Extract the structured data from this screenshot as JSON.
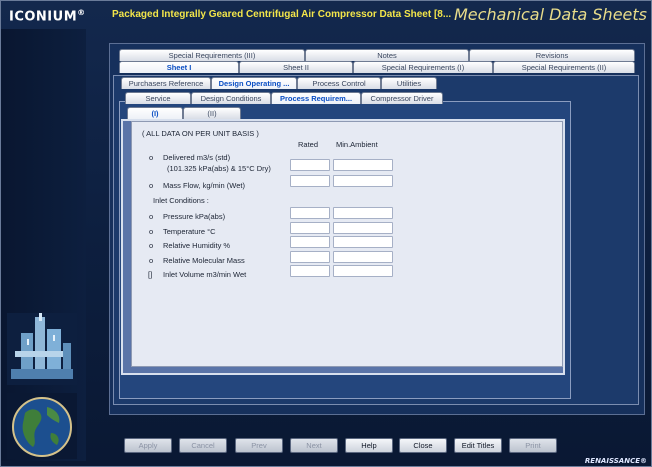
{
  "header": {
    "logo": "ICONIUM",
    "logo_mark": "®",
    "title": "Packaged Integrally Geared Centrifugal Air Compressor Data Sheet [8...",
    "module": "Mechanical Data Sheets"
  },
  "tabs_row1": [
    "Special Requirements (III)",
    "Notes",
    "Revisions"
  ],
  "tabs_row2": [
    "Sheet I",
    "Sheet II",
    "Special Requirements (I)",
    "Special Requirements (II)"
  ],
  "tabs_row3": [
    "Purchasers Reference",
    "Design Operating ...",
    "Process Control",
    "Utilities"
  ],
  "tabs_row4": [
    "Service",
    "Design Conditions",
    "Process Requirem...",
    "Compressor Driver"
  ],
  "tabs_row5": [
    "(I)",
    "(II)"
  ],
  "form": {
    "note": "( ALL DATA ON PER UNIT BASIS )",
    "col_rated": "Rated",
    "col_min_ambient": "Min.Ambient",
    "rows": [
      {
        "bullet": "o",
        "label": "Delivered m3/s (std)",
        "sub": "(101.325 kPa(abs) & 15°C Dry)"
      },
      {
        "bullet": "o",
        "label": "Mass Flow, kg/min (Wet)"
      },
      {
        "bullet": "",
        "label": "Inlet Conditions :"
      },
      {
        "bullet": "o",
        "label": "Pressure kPa(abs)"
      },
      {
        "bullet": "o",
        "label": "Temperature °C"
      },
      {
        "bullet": "o",
        "label": "Relative Humidity %"
      },
      {
        "bullet": "o",
        "label": "Relative Molecular Mass"
      },
      {
        "bullet": "[]",
        "label": "Inlet Volume m3/min  Wet"
      }
    ]
  },
  "buttons": {
    "apply": "Apply",
    "cancel": "Cancel",
    "prev": "Prev",
    "next": "Next",
    "help": "Help",
    "close": "Close",
    "edit_titles": "Edit Titles",
    "print": "Print"
  },
  "footer_brand": "RENAISSANCE®",
  "colors": {
    "title_yellow": "#f3e64a",
    "active_tab_blue": "#0b4fc4",
    "background_navy": "#0d1f3f"
  }
}
